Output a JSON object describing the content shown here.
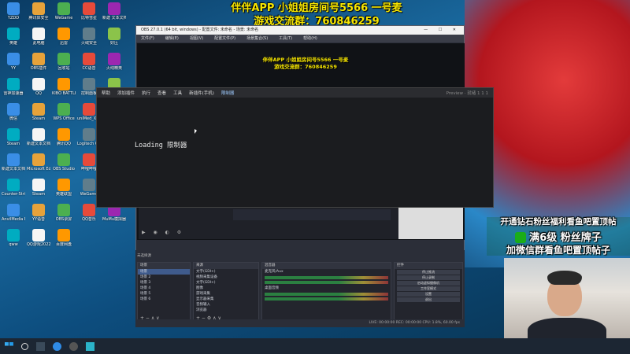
{
  "banner": {
    "line1": "伴伴APP 小姐姐房间号5566 一号麦",
    "line2": "游戏交流群：760846259"
  },
  "desktop_icons": [
    "YZDD",
    "腾讯体安全",
    "WeGame",
    "比特彗星",
    "新建 文本文档",
    "英雄",
    "此电脑",
    "迅雷",
    "火绒安全",
    "好压",
    "YY",
    "OBS插件",
    "回收站",
    "CC语音",
    "火线精英",
    "雷神加速器",
    "QQ",
    "KIBO BATTLE",
    "控制面板",
    "网易云",
    "微信",
    "Steam",
    "WPS Office",
    "uniMed_XR 14",
    "TL Esports",
    "Steam",
    "新建文本文档 (2)",
    "腾讯QQ",
    "Logitech G HUB",
    "网易UU加速器",
    "新建文本文档",
    "Microsoft Edge",
    "OBS Studio",
    "哔哩哔哩",
    "WPS Office",
    "Counter-Strike 2",
    "Steam",
    "英雄联盟",
    "WeGame",
    "ToDesk",
    "AnvilMedia Reader",
    "YY语音",
    "OBS录屏",
    "QQ音乐",
    "MuMu模拟器",
    "qww",
    "QQ游戏2022",
    "百度网盘"
  ],
  "front_window": {
    "menu": [
      "帮助",
      "添加插件",
      "执行",
      "查看",
      "工具",
      "新插件(手机)",
      "限制器"
    ],
    "right_info": "Preview · 就绪 1 1 1",
    "loading_text": "Loading 限制器"
  },
  "obs_window": {
    "title": "OBS 27.0.1 (64 bit, windows) - 配置文件: 未命名 - 场景: 未命名",
    "controls": "— ☐ ✕",
    "menu": [
      "文件(F)",
      "编辑(E)",
      "视图(V)",
      "配置文件(P)",
      "场景集合(S)",
      "工具(T)",
      "帮助(H)"
    ],
    "dock_header": "未选择源",
    "panels": {
      "scenes": {
        "title": "场景",
        "items": [
          "场景",
          "场景 2",
          "场景 3",
          "场景 4",
          "场景 5",
          "场景 6"
        ]
      },
      "sources": {
        "title": "来源",
        "items": [
          "文字(GDI+)",
          "视频采集设备",
          "文字(GDI+)",
          "图像",
          "游戏采集",
          "显示器采集",
          "音频输入",
          "浏览器"
        ]
      },
      "mixer": {
        "title": "混音器",
        "items": [
          "麦克风/Aux",
          "桌面音频"
        ]
      },
      "controls": {
        "title": "控件",
        "items": [
          "停止推流",
          "停止录制",
          "启动虚拟摄像机",
          "工作室模式",
          "设置",
          "退出"
        ]
      }
    },
    "status": "LIVE: 00:00:00    REC: 00:00:00    CPU: 1.8%, 60.00 fps"
  },
  "promo": {
    "line1": "开通钻石粉丝福利看鱼吧置顶帖",
    "line2": "满6级 粉丝牌子",
    "line3": "加微信群看鱼吧置顶帖子"
  },
  "colors": {
    "banner": "#f7e600",
    "obs_bg": "#2b2e38",
    "taskbar": "#1c2633"
  }
}
